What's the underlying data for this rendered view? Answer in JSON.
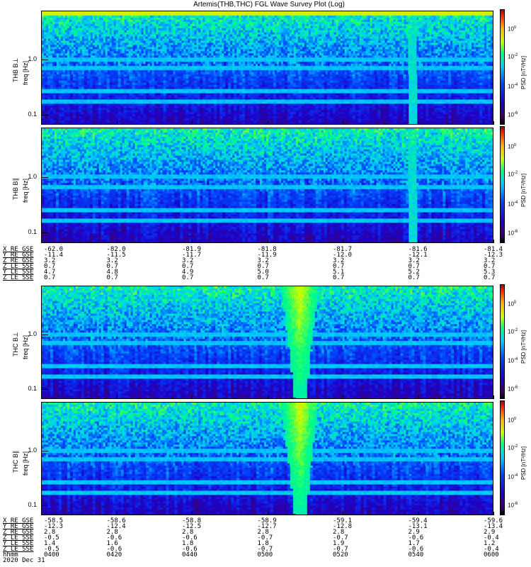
{
  "chart_data": {
    "type": "heatmap",
    "title": "Artemis(THB,THC) FGL Wave Survey Plot (Log)",
    "panels": [
      {
        "id": "thb-bperp",
        "label": "THB B⊥",
        "ylabel": "freq [Hz]",
        "yticks": [
          "1.0",
          "0.1"
        ],
        "colorbar_label": "PSD [nT²/Hz]",
        "colorbar_ticks": [
          "0",
          "-2",
          "-4",
          "-6"
        ],
        "features": {
          "spike_time_fraction": 0.82,
          "top_bright": true
        }
      },
      {
        "id": "thb-bpar",
        "label": "THB B∥",
        "ylabel": "freq [Hz]",
        "yticks": [
          "1.0",
          "0.1"
        ],
        "colorbar_label": "PSD [nT²/Hz]",
        "colorbar_ticks": [
          "0",
          "-2",
          "-4",
          "-6"
        ],
        "features": {
          "spike_time_fraction": 0.82,
          "top_bright": false
        }
      },
      {
        "id": "thc-bperp",
        "label": "THC B⊥",
        "ylabel": "freq [Hz]",
        "yticks": [
          "1.0",
          "0.1"
        ],
        "colorbar_label": "PSD [nT²/Hz]",
        "colorbar_ticks": [
          "0",
          "-2",
          "-4",
          "-6"
        ],
        "features": {
          "spike_time_fraction": 0.57,
          "top_bright": false
        }
      },
      {
        "id": "thc-bpar",
        "label": "THC B∥",
        "ylabel": "freq [Hz]",
        "yticks": [
          "1.0",
          "0.1"
        ],
        "colorbar_label": "PSD [nT²/Hz]",
        "colorbar_ticks": [
          "0",
          "-2",
          "-4",
          "-6"
        ],
        "features": {
          "spike_time_fraction": 0.57,
          "top_bright": false
        }
      }
    ],
    "colorbar_base": "10",
    "ephemeris_thb": {
      "labels": [
        "X_RE_GSE",
        "Y_RE_GSE",
        "Z_RE_GSE",
        "Z_LE_SSE",
        "Y_LE_SSE",
        "Z_LE_SSE"
      ],
      "rows": [
        [
          "-62.0",
          "-82.0",
          "-81.9",
          "-81.8",
          "-81.7",
          "-81.6",
          "-81.4"
        ],
        [
          "-11.4",
          "-11.5",
          "-11.7",
          "-11.9",
          "-12.0",
          "-12.1",
          "-12.3"
        ],
        [
          "3.2",
          "3.2",
          "3.2",
          "3.2",
          "3.2",
          "3.2",
          "3.2"
        ],
        [
          "0.7",
          "0.7",
          "0.7",
          "0.7",
          "0.7",
          "0.7",
          "0.7"
        ],
        [
          "4.7",
          "4.8",
          "4.9",
          "5.0",
          "5.1",
          "5.2",
          "5.3"
        ],
        [
          "0.7",
          "0.7",
          "0.7",
          "0.7",
          "0.7",
          "0.7",
          "0.7"
        ]
      ]
    },
    "ephemeris_thc": {
      "labels": [
        "X_RE_GSE",
        "Y_RE_GSE",
        "Z_RE_GSE",
        "Z_LE_SSE",
        "Y_LE_SSE",
        "Z_LE_SSE",
        "hhmm"
      ],
      "rows": [
        [
          "-58.5",
          "-58.6",
          "-58.8",
          "-58.9",
          "-59.1",
          "-59.4",
          "-59.6"
        ],
        [
          "-12.3",
          "-12.4",
          "-12.5",
          "-12.7",
          "-12.8",
          "-13.1",
          "-13.4"
        ],
        [
          "2.8",
          "2.8",
          "2.8",
          "2.8",
          "2.8",
          "2.9",
          "2.9"
        ],
        [
          "-0.5",
          "-0.6",
          "-0.6",
          "-0.7",
          "-0.7",
          "-0.6",
          "-0.4"
        ],
        [
          "1.4",
          "1.6",
          "1.8",
          "1.8",
          "1.9",
          "1.7",
          "1.2"
        ],
        [
          "-0.5",
          "-0.6",
          "-0.6",
          "-0.7",
          "-0.7",
          "-0.6",
          "-0.4"
        ],
        [
          "0400",
          "0420",
          "0440",
          "0500",
          "0520",
          "0540",
          "0600"
        ]
      ],
      "date": "2020 Dec 31"
    }
  }
}
